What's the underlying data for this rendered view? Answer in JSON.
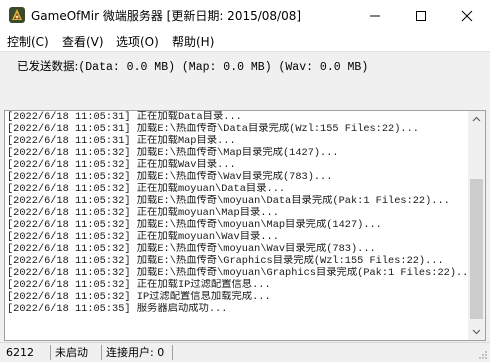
{
  "window": {
    "title": "GameOfMir 微端服务器 [更新日期: 2015/08/08]",
    "icon": "game-app-icon",
    "controls": [
      "minimize-icon",
      "maximize-icon",
      "close-icon"
    ]
  },
  "menu": {
    "items": [
      {
        "label": "控制(C)"
      },
      {
        "label": "查看(V)"
      },
      {
        "label": "选项(O)"
      },
      {
        "label": "帮助(H)"
      }
    ]
  },
  "stats": {
    "label": "已发送数据:",
    "value": "(Data: 0.0 MB) (Map: 0.0 MB) (Wav: 0.0 MB)"
  },
  "log": {
    "lines": [
      "[2022/6/18 11:05:31] 正在加载Data目录...",
      "[2022/6/18 11:05:31] 加载E:\\热血传奇\\Data目录完成(Wzl:155 Files:22)...",
      "[2022/6/18 11:05:31] 正在加载Map目录...",
      "[2022/6/18 11:05:32] 加载E:\\热血传奇\\Map目录完成(1427)...",
      "[2022/6/18 11:05:32] 正在加载Wav目录...",
      "[2022/6/18 11:05:32] 加载E:\\热血传奇\\Wav目录完成(783)...",
      "[2022/6/18 11:05:32] 正在加载moyuan\\Data目录...",
      "[2022/6/18 11:05:32] 加载E:\\热血传奇\\moyuan\\Data目录完成(Pak:1 Files:22)...",
      "[2022/6/18 11:05:32] 正在加载moyuan\\Map目录...",
      "[2022/6/18 11:05:32] 加载E:\\热血传奇\\moyuan\\Map目录完成(1427)...",
      "[2022/6/18 11:05:32] 正在加载moyuan\\Wav目录...",
      "[2022/6/18 11:05:32] 加载E:\\热血传奇\\moyuan\\Wav目录完成(783)...",
      "[2022/6/18 11:05:32] 加载E:\\热血传奇\\Graphics目录完成(Wzl:155 Files:22)...",
      "[2022/6/18 11:05:32] 加载E:\\热血传奇\\moyuan\\Graphics目录完成(Pak:1 Files:22)...",
      "[2022/6/18 11:05:32] 正在加载IP过滤配置信息...",
      "[2022/6/18 11:05:32] IP过滤配置信息加载完成...",
      "[2022/6/18 11:05:35] 服务器启动成功..."
    ]
  },
  "statusbar": {
    "port": "6212",
    "state": "未启动",
    "connections": "连接用户: 0"
  },
  "colors": {
    "titlebar": "#ffffff",
    "window_bg": "#f0f0f0",
    "log_bg": "#ffffff",
    "scroll_thumb": "#cdcdcd"
  }
}
